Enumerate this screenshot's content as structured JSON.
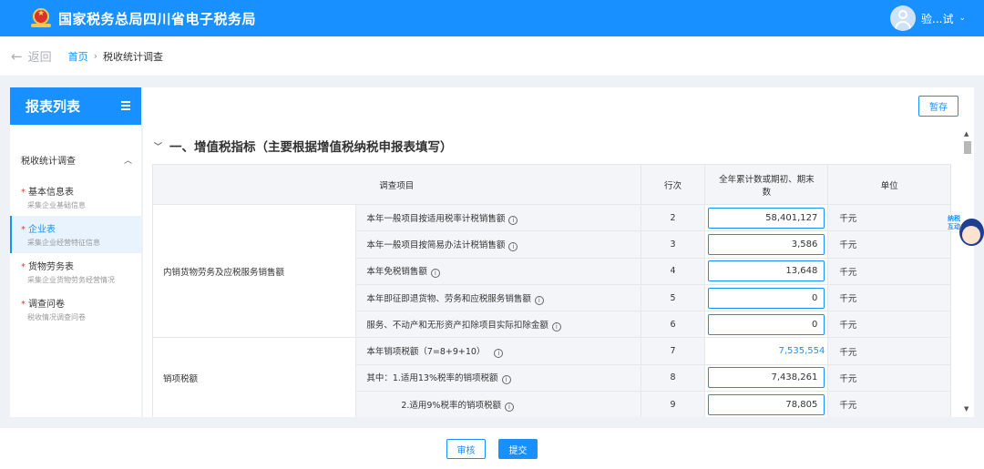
{
  "header": {
    "site_title": "国家税务总局四川省电子税务局",
    "user_name": "验...试",
    "brand_color": "#1890ff"
  },
  "breadcrumb": {
    "back_label": "返回",
    "home": "首页",
    "separator": "›",
    "current": "税收统计调查"
  },
  "sidebar": {
    "title": "报表列表",
    "group_label": "税收统计调查",
    "items": [
      {
        "label": "基本信息表",
        "desc": "采集企业基础信息",
        "required": "*"
      },
      {
        "label": "企业表",
        "desc": "采集企业经营特征信息",
        "required": "*"
      },
      {
        "label": "货物劳务表",
        "desc": "采集企业货物劳务经营情况",
        "required": "*"
      },
      {
        "label": "调查问卷",
        "desc": "税收情况调查问卷",
        "required": "*"
      }
    ]
  },
  "main": {
    "save_label": "暂存",
    "section_title": "一、增值税指标（主要根据增值税纳税申报表填写）",
    "table": {
      "headers": {
        "item": "调查项目",
        "line": "行次",
        "value_a": "全年累计数或期初、期末",
        "value_b": "数",
        "unit": "单位"
      },
      "category_1": "内销货物劳务及应税服务销售额",
      "category_2": "销项税额",
      "rows": [
        {
          "item": "本年一般项目按适用税率计税销售额",
          "line": "2",
          "value": "58,401,127",
          "unit": "千元"
        },
        {
          "item": "本年一般项目按简易办法计税销售额",
          "line": "3",
          "value": "3,586",
          "unit": "千元"
        },
        {
          "item": "本年免税销售额",
          "line": "4",
          "value": "13,648",
          "unit": "千元"
        },
        {
          "item": "本年即征即退货物、劳务和应税服务销售额",
          "line": "5",
          "value": "0",
          "unit": "千元"
        },
        {
          "item": "服务、不动产和无形资产扣除项目实际扣除金额",
          "line": "6",
          "value": "0",
          "unit": "千元"
        },
        {
          "item": "本年销项税额（7=8+9+10）",
          "line": "7",
          "value": "7,535,554",
          "unit": "千元"
        },
        {
          "item": "其中：1.适用13%税率的销项税额",
          "line": "8",
          "value": "7,438,261",
          "unit": "千元"
        },
        {
          "item": "2.适用9%税率的销项税额",
          "line": "9",
          "value": "78,805",
          "unit": "千元"
        }
      ]
    }
  },
  "helper": {
    "tag": "纳税互动"
  },
  "footer": {
    "review_label": "审核",
    "submit_label": "提交"
  }
}
